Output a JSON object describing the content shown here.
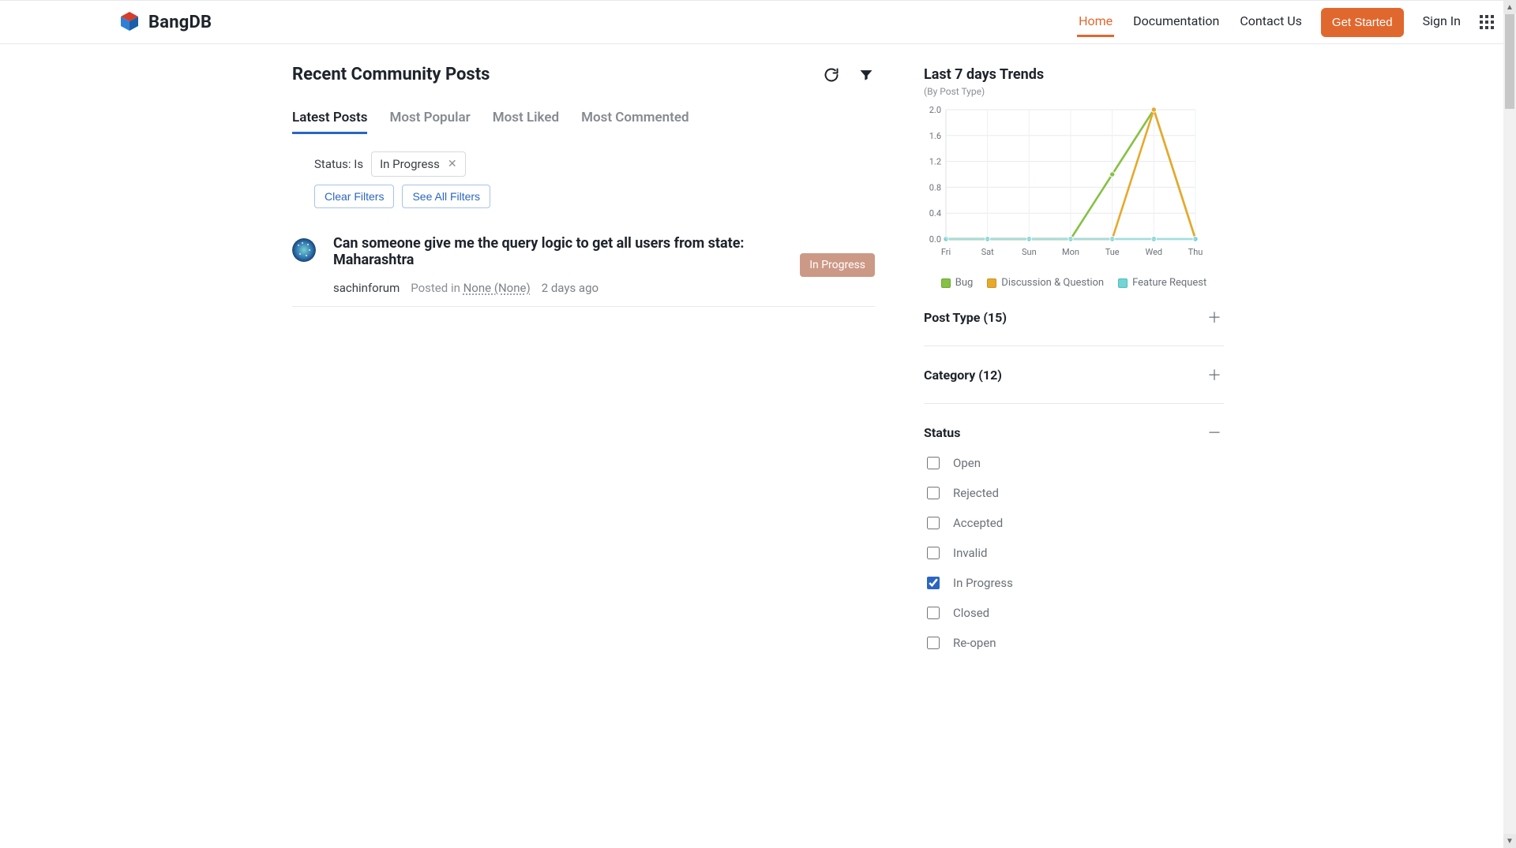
{
  "brand": {
    "name": "BangDB"
  },
  "nav": {
    "home": "Home",
    "docs": "Documentation",
    "contact": "Contact Us",
    "cta": "Get Started",
    "signin": "Sign In"
  },
  "page": {
    "title": "Recent Community Posts"
  },
  "tabs": {
    "latest": "Latest Posts",
    "popular": "Most Popular",
    "liked": "Most Liked",
    "commented": "Most Commented"
  },
  "filters": {
    "label": "Status: Is",
    "chip_value": "In Progress",
    "clear": "Clear Filters",
    "see_all": "See All Filters"
  },
  "posts": [
    {
      "title": "Can someone give me the query logic to get all users from state: Maharashtra",
      "author": "sachinforum",
      "posted_in_label": "Posted in",
      "posted_in_value": "None (None)",
      "time": "2 days ago",
      "status": "In Progress"
    }
  ],
  "aside": {
    "title": "Last 7 days Trends",
    "subtitle": "(By Post Type)",
    "legend": {
      "bug": "Bug",
      "disc": "Discussion & Question",
      "feat": "Feature Request"
    }
  },
  "facets": {
    "post_type": "Post Type (15)",
    "category": "Category (12)",
    "status_title": "Status",
    "status_items": [
      {
        "label": "Open",
        "checked": false
      },
      {
        "label": "Rejected",
        "checked": false
      },
      {
        "label": "Accepted",
        "checked": false
      },
      {
        "label": "Invalid",
        "checked": false
      },
      {
        "label": "In Progress",
        "checked": true
      },
      {
        "label": "Closed",
        "checked": false
      },
      {
        "label": "Re-open",
        "checked": false
      }
    ]
  },
  "chart_data": {
    "type": "line",
    "categories": [
      "Fri",
      "Sat",
      "Sun",
      "Mon",
      "Tue",
      "Wed",
      "Thu"
    ],
    "series": [
      {
        "name": "Bug",
        "color": "#86c146",
        "values": [
          0,
          0,
          0,
          0,
          1.0,
          2.0,
          0
        ]
      },
      {
        "name": "Discussion & Question",
        "color": "#e6a92b",
        "values": [
          0,
          0,
          0,
          0,
          0,
          2.0,
          0
        ]
      },
      {
        "name": "Feature Request",
        "color": "#6fd5d5",
        "values": [
          0,
          0,
          0,
          0,
          0,
          0,
          0
        ]
      }
    ],
    "ylim": [
      0,
      2.0
    ],
    "yticks": [
      0,
      0.4,
      0.8,
      1.2,
      1.6,
      2.0
    ],
    "title": "Last 7 days Trends",
    "ylabel": "",
    "xlabel": ""
  }
}
